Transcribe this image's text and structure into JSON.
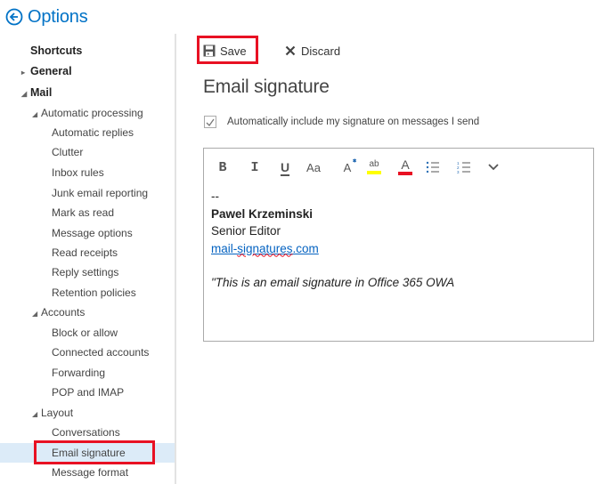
{
  "header": {
    "title": "Options",
    "back_icon": "circle-arrow-left-icon"
  },
  "sidebar": {
    "items": [
      {
        "label": "Shortcuts",
        "level": 0,
        "expander": "none"
      },
      {
        "label": "General",
        "level": 0,
        "expander": "collapsed"
      },
      {
        "label": "Mail",
        "level": 0,
        "expander": "expanded"
      },
      {
        "label": "Automatic processing",
        "level": 1,
        "expander": "expanded"
      },
      {
        "label": "Automatic replies",
        "level": 2
      },
      {
        "label": "Clutter",
        "level": 2
      },
      {
        "label": "Inbox rules",
        "level": 2
      },
      {
        "label": "Junk email reporting",
        "level": 2
      },
      {
        "label": "Mark as read",
        "level": 2
      },
      {
        "label": "Message options",
        "level": 2
      },
      {
        "label": "Read receipts",
        "level": 2
      },
      {
        "label": "Reply settings",
        "level": 2
      },
      {
        "label": "Retention policies",
        "level": 2
      },
      {
        "label": "Accounts",
        "level": 1,
        "expander": "expanded"
      },
      {
        "label": "Block or allow",
        "level": 2
      },
      {
        "label": "Connected accounts",
        "level": 2
      },
      {
        "label": "Forwarding",
        "level": 2
      },
      {
        "label": "POP and IMAP",
        "level": 2
      },
      {
        "label": "Layout",
        "level": 1,
        "expander": "expanded"
      },
      {
        "label": "Conversations",
        "level": 2
      },
      {
        "label": "Email signature",
        "level": 2,
        "selected": true
      },
      {
        "label": "Message format",
        "level": 2
      }
    ]
  },
  "toolbar": {
    "save_label": "Save",
    "save_icon": "floppy-disk-icon",
    "discard_label": "Discard",
    "discard_icon": "x-icon"
  },
  "main": {
    "title": "Email signature",
    "auto_include": {
      "label": "Automatically include my signature on messages I send",
      "checked": true
    }
  },
  "editor": {
    "format_buttons": [
      {
        "name": "bold",
        "glyph": "B"
      },
      {
        "name": "italic",
        "glyph": "I"
      },
      {
        "name": "underline",
        "glyph": "U"
      },
      {
        "name": "font-size",
        "glyph": "Aa"
      },
      {
        "name": "grow-shrink-font",
        "glyph": "A"
      },
      {
        "name": "highlight",
        "glyph": "ab"
      },
      {
        "name": "font-color",
        "glyph": "A"
      },
      {
        "name": "bullets",
        "glyph": ""
      },
      {
        "name": "numbering",
        "glyph": ""
      },
      {
        "name": "more",
        "glyph": ""
      }
    ],
    "highlight_color": "#ffff00",
    "font_color": "#e81123",
    "signature": {
      "separator": "--",
      "name": "Pawel Krzeminski",
      "role": "Senior Editor",
      "link_prefix": "mail-",
      "link_misspelled": "signatures",
      "link_suffix": ".com",
      "quote": "\"This is an email signature in Office 365 OWA"
    }
  },
  "colors": {
    "accent": "#0072c6",
    "highlight_box": "#e81123",
    "selected_bg": "#dcebf8"
  }
}
